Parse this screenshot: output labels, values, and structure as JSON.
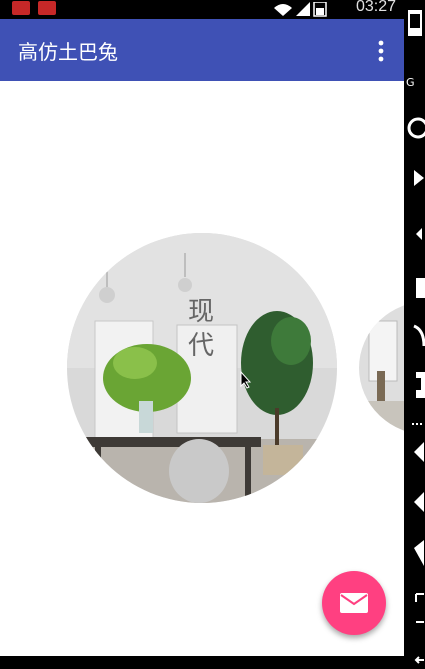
{
  "status_bar": {
    "time": "03:27",
    "notification_icons": [
      "app-notification-icon",
      "app-notification-icon"
    ]
  },
  "app_bar": {
    "title": "高仿土巴兔",
    "menu_icon": "more-vert-icon"
  },
  "carousel": {
    "current_label": "现代",
    "side_item_icon": "room-photo"
  },
  "fab": {
    "icon": "mail-icon",
    "color": "#ff4081"
  },
  "colors": {
    "primary": "#3f51b5",
    "accent": "#ff4081"
  }
}
